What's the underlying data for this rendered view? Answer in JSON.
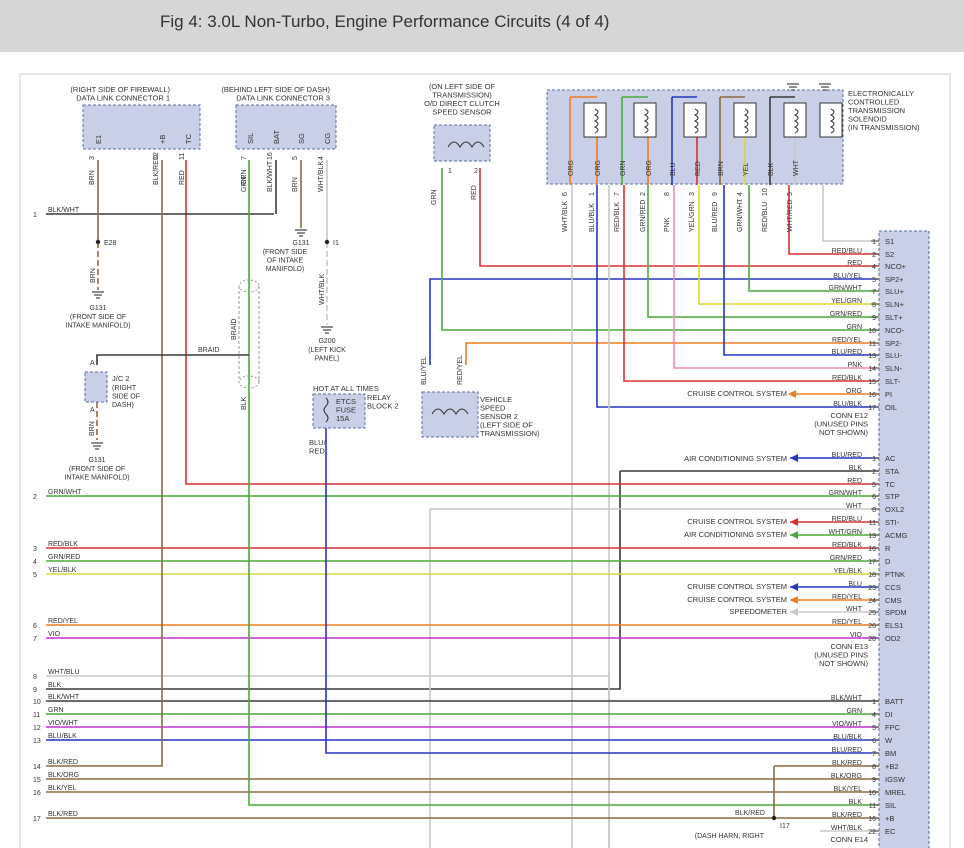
{
  "header": {
    "title": "Fig 4: 3.0L Non-Turbo, Engine Performance Circuits (4 of 4)"
  },
  "colors": {
    "background": "#ffffff",
    "header_bg": "#d6d6d6",
    "connector_fill": "#c9cfe6",
    "connector_stroke": "#5a6fa0",
    "blk": "#3a3a3a",
    "brn": "#8a6a40",
    "red": "#d83030",
    "grn": "#4caa3a",
    "blu": "#2535c0",
    "org": "#f07d20",
    "yel": "#d8d830",
    "vio": "#c030d0",
    "wht": "#c8c8c8",
    "pnk": "#f08ab8"
  },
  "dlc1": {
    "location": [
      "(RIGHT SIDE OF FIREWALL)",
      "DATA LINK CONNECTOR 1"
    ],
    "pins": [
      {
        "pin": "3",
        "label": "E1"
      },
      {
        "pin": "12",
        "label": "+B"
      },
      {
        "pin": "11",
        "label": "TC"
      }
    ],
    "wire_labels": [
      "BRN",
      "BLK/RED",
      "RED"
    ]
  },
  "dlc3": {
    "location": [
      "(BEHIND LEFT SIDE OF DASH)",
      "DATA LINK CONNECTOR 3"
    ],
    "pins": [
      {
        "pin": "7",
        "label": "SIL"
      },
      {
        "pin": "16",
        "label": "BAT"
      },
      {
        "pin": "5",
        "label": "SG"
      },
      {
        "pin": "4",
        "label": "CG"
      }
    ],
    "wire_labels": [
      "GRN",
      "BLK/WHT",
      "BRN",
      "WHT/BLK"
    ]
  },
  "odsensor": {
    "location": [
      "(ON LEFT SIDE OF",
      "TRANSMISSION)",
      "O/D DIRECT CLUTCH",
      "SPEED SENSOR"
    ],
    "pins": [
      "1",
      "2"
    ],
    "wire_labels": [
      "GRN",
      "RED"
    ]
  },
  "ects": {
    "location": [
      "ELECTRONICALLY",
      "CONTROLLED",
      "TRANSMISSION",
      "SOLENOID",
      "(IN TRANSMISSION)"
    ],
    "inner_wires": [
      "ORG",
      "ORG",
      "GRN",
      "ORG",
      "BLU",
      "RED",
      "BRN",
      "YEL",
      "BLK",
      "WHT"
    ],
    "pins": [
      "6",
      "1",
      "7",
      "2",
      "8",
      "3",
      "9",
      "4",
      "10",
      "5"
    ],
    "out_wires": [
      "WHT/BLK",
      "BLU/BLK",
      "RED/BLK",
      "GRN/RED",
      "PNK",
      "YEL/GRN",
      "BLU/RED",
      "GRN/WHT",
      "RED/BLU",
      "WHT/RED"
    ]
  },
  "grounds": {
    "e28": "E28",
    "g131_top": "G131",
    "g131_top_loc": [
      "(FRONT SIDE OF",
      "INTAKE MANIFOLD)"
    ],
    "g131_mid": "G131",
    "g131_mid_loc": [
      "(FRONT SIDE",
      "OF INTAKE",
      "MANIFOLD)"
    ],
    "i1": "I1",
    "g200": "G200",
    "g200_loc": [
      "(LEFT KICK",
      "PANEL)"
    ],
    "g131_bot": "G131",
    "g131_bot_loc": [
      "(FRONT SIDE OF",
      "INTAKE MANIFOLD)"
    ],
    "brn": "BRN",
    "wht_blk": "WHT/BLK",
    "braid": "BRAID",
    "blk": "BLK"
  },
  "jc2": {
    "name": "J/C 2",
    "loc": [
      "(RIGHT",
      "SIDE OF",
      "DASH)"
    ],
    "pin_a": "A"
  },
  "relay": {
    "hot": "HOT AT ALL TIMES",
    "name": [
      "RELAY",
      "BLOCK 2"
    ],
    "fuse": [
      "ETCS",
      "FUSE",
      "15A"
    ],
    "out": [
      "BLU/",
      "RED"
    ]
  },
  "vss2": {
    "wires": [
      "BLU/YEL",
      "RED/YEL"
    ],
    "label": [
      "VEHICLE",
      "SPEED",
      "SENSOR 2",
      "(LEFT SIDE OF",
      "TRANSMISSION)"
    ]
  },
  "ecm": {
    "e12": {
      "name": "CONN E12",
      "note": [
        "(UNUSED PINS",
        "NOT SHOWN)"
      ]
    },
    "e13": {
      "name": "CONN E13",
      "note": [
        "(UNUSED PINS",
        "NOT SHOWN)"
      ]
    },
    "e14": {
      "name": "CONN E14"
    },
    "rows": [
      {
        "wire": "",
        "pin": "1",
        "sig": "S1"
      },
      {
        "wire": "RED/BLU",
        "pin": "2",
        "sig": "S2"
      },
      {
        "wire": "RED",
        "pin": "4",
        "sig": "NCO+"
      },
      {
        "wire": "BLU/YEL",
        "pin": "5",
        "sig": "SP2+"
      },
      {
        "wire": "GRN/WHT",
        "pin": "7",
        "sig": "SLU+"
      },
      {
        "wire": "YEL/GRN",
        "pin": "8",
        "sig": "SLN+"
      },
      {
        "wire": "GRN/RED",
        "pin": "9",
        "sig": "SLT+"
      },
      {
        "wire": "GRN",
        "pin": "10",
        "sig": "NCO-"
      },
      {
        "wire": "RED/YEL",
        "pin": "11",
        "sig": "SP2-"
      },
      {
        "wire": "BLU/RED",
        "pin": "13",
        "sig": "SLU-"
      },
      {
        "wire": "PNK",
        "pin": "14",
        "sig": "SLN-"
      },
      {
        "wire": "RED/BLK",
        "pin": "15",
        "sig": "SLT-"
      },
      {
        "wire": "ORG",
        "pin": "16",
        "sig": "PI"
      },
      {
        "wire": "BLU/BLK",
        "pin": "17",
        "sig": "OIL"
      },
      {
        "wire": "BLU/RED",
        "pin": "1",
        "sig": "AC"
      },
      {
        "wire": "BLK",
        "pin": "2",
        "sig": "STA"
      },
      {
        "wire": "RED",
        "pin": "5",
        "sig": "TC"
      },
      {
        "wire": "GRN/WHT",
        "pin": "6",
        "sig": "STP"
      },
      {
        "wire": "WHT",
        "pin": "8",
        "sig": "OXL2"
      },
      {
        "wire": "RED/BLU",
        "pin": "11",
        "sig": "STI-"
      },
      {
        "wire": "WHT/GRN",
        "pin": "13",
        "sig": "ACMG"
      },
      {
        "wire": "RED/BLK",
        "pin": "16",
        "sig": "R"
      },
      {
        "wire": "GRN/RED",
        "pin": "17",
        "sig": "D"
      },
      {
        "wire": "YEL/BLK",
        "pin": "18",
        "sig": "PTNK"
      },
      {
        "wire": "BLU",
        "pin": "23",
        "sig": "CCS"
      },
      {
        "wire": "RED/YEL",
        "pin": "24",
        "sig": "CMS"
      },
      {
        "wire": "WHT",
        "pin": "25",
        "sig": "SPDM"
      },
      {
        "wire": "RED/YEL",
        "pin": "26",
        "sig": "ELS1"
      },
      {
        "wire": "VIO",
        "pin": "28",
        "sig": "OD2"
      },
      {
        "wire": "BLK/WHT",
        "pin": "1",
        "sig": "BATT"
      },
      {
        "wire": "GRN",
        "pin": "4",
        "sig": "DI"
      },
      {
        "wire": "VIO/WHT",
        "pin": "5",
        "sig": "FPC"
      },
      {
        "wire": "BLU/BLK",
        "pin": "6",
        "sig": "W"
      },
      {
        "wire": "BLU/RED",
        "pin": "7",
        "sig": "BM"
      },
      {
        "wire": "BLK/RED",
        "pin": "8",
        "sig": "+B2"
      },
      {
        "wire": "BLK/ORG",
        "pin": "9",
        "sig": "IGSW"
      },
      {
        "wire": "BLK/YEL",
        "pin": "10",
        "sig": "MREL"
      },
      {
        "wire": "BLK",
        "pin": "11",
        "sig": "SIL"
      },
      {
        "wire": "BLK/RED",
        "pin": "16",
        "sig": "+B"
      },
      {
        "wire": "WHT/BLK",
        "pin": "22",
        "sig": "EC"
      }
    ]
  },
  "destinations": {
    "cruise_pi": "CRUISE CONTROL SYSTEM",
    "ac1": "AIR CONDITIONING SYSTEM",
    "cruise_sti": "CRUISE CONTROL SYSTEM",
    "ac2": "AIR CONDITIONING SYSTEM",
    "cruise_ccs": "CRUISE CONTROL SYSTEM",
    "cruise_cms": "CRUISE CONTROL SYSTEM",
    "speedo": "SPEEDOMETER"
  },
  "left_wires": [
    {
      "num": "1",
      "label": "BLK/WHT"
    },
    {
      "num": "2",
      "label": "GRN/WHT"
    },
    {
      "num": "3",
      "label": "RED/BLK"
    },
    {
      "num": "4",
      "label": "GRN/RED"
    },
    {
      "num": "5",
      "label": "YEL/BLK"
    },
    {
      "num": "6",
      "label": "RED/YEL"
    },
    {
      "num": "7",
      "label": "VIO"
    },
    {
      "num": "8",
      "label": "WHT/BLU"
    },
    {
      "num": "9",
      "label": "BLK"
    },
    {
      "num": "10",
      "label": "BLK/WHT"
    },
    {
      "num": "11",
      "label": "GRN"
    },
    {
      "num": "12",
      "label": "VIO/WHT"
    },
    {
      "num": "13",
      "label": "BLU/BLK"
    },
    {
      "num": "14",
      "label": "BLK/RED"
    },
    {
      "num": "15",
      "label": "BLK/ORG"
    },
    {
      "num": "16",
      "label": "BLK/YEL"
    },
    {
      "num": "17",
      "label": "BLK/RED"
    }
  ],
  "i17": {
    "name": "I17",
    "wire": "BLK/RED",
    "loc": "(DASH HARN, RIGHT"
  }
}
